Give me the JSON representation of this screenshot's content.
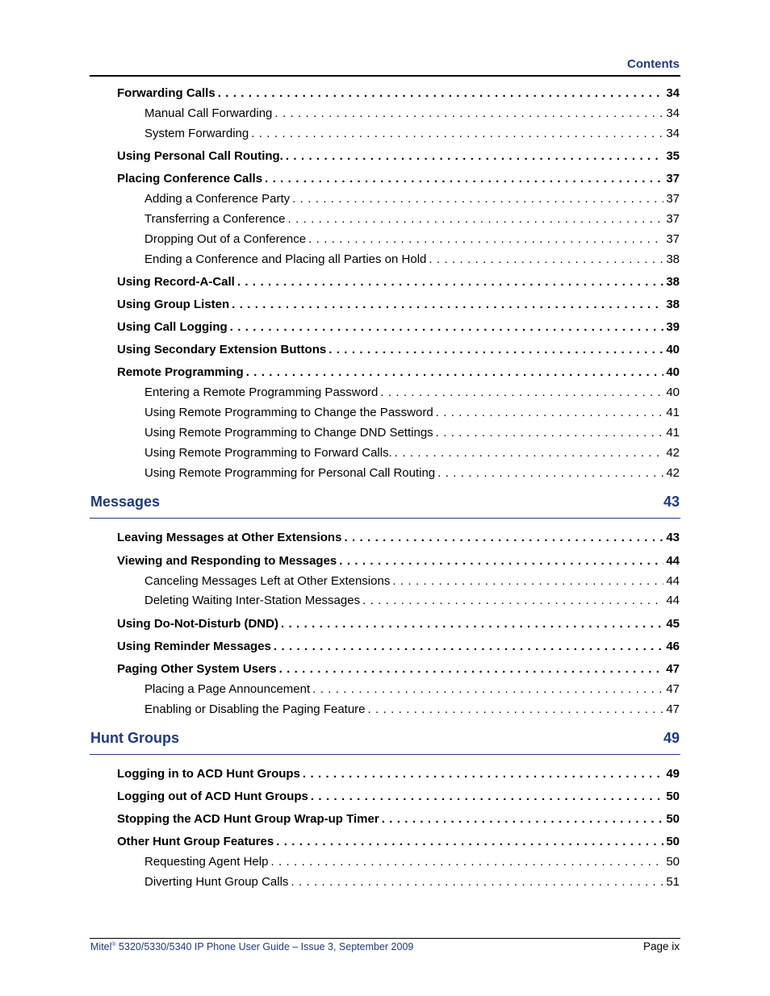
{
  "header": {
    "title": "Contents"
  },
  "sections": [
    {
      "level": 1,
      "title": "Forwarding Calls",
      "page": "34"
    },
    {
      "level": 2,
      "title": "Manual Call Forwarding",
      "page": "34"
    },
    {
      "level": 2,
      "title": "System Forwarding",
      "page": "34"
    },
    {
      "level": 1,
      "title": "Using Personal Call Routing.",
      "page": "35"
    },
    {
      "level": 1,
      "title": "Placing Conference Calls",
      "page": "37"
    },
    {
      "level": 2,
      "title": "Adding a Conference Party",
      "page": "37"
    },
    {
      "level": 2,
      "title": "Transferring a Conference",
      "page": "37"
    },
    {
      "level": 2,
      "title": "Dropping Out of a Conference",
      "page": "37"
    },
    {
      "level": 2,
      "title": "Ending a Conference and Placing all Parties on Hold",
      "page": "38"
    },
    {
      "level": 1,
      "title": "Using Record-A-Call",
      "page": "38"
    },
    {
      "level": 1,
      "title": "Using Group Listen",
      "page": "38"
    },
    {
      "level": 1,
      "title": "Using Call Logging",
      "page": "39"
    },
    {
      "level": 1,
      "title": "Using Secondary Extension Buttons",
      "page": "40"
    },
    {
      "level": 1,
      "title": "Remote Programming",
      "page": "40"
    },
    {
      "level": 2,
      "title": "Entering a Remote Programming Password",
      "page": "40"
    },
    {
      "level": 2,
      "title": "Using Remote Programming to Change the Password",
      "page": "41"
    },
    {
      "level": 2,
      "title": "Using Remote Programming to Change DND Settings",
      "page": "41"
    },
    {
      "level": 2,
      "title": "Using Remote Programming to Forward Calls.",
      "page": "42"
    },
    {
      "level": 2,
      "title": "Using Remote Programming for Personal Call Routing",
      "page": "42"
    }
  ],
  "chapters": [
    {
      "title": "Messages",
      "page": "43",
      "entries": [
        {
          "level": 1,
          "title": "Leaving Messages at Other Extensions",
          "page": "43"
        },
        {
          "level": 1,
          "title": "Viewing and Responding to Messages",
          "page": "44"
        },
        {
          "level": 2,
          "title": "Canceling Messages Left at Other Extensions",
          "page": "44"
        },
        {
          "level": 2,
          "title": "Deleting Waiting Inter-Station Messages",
          "page": "44"
        },
        {
          "level": 1,
          "title": "Using Do-Not-Disturb (DND)",
          "page": "45"
        },
        {
          "level": 1,
          "title": "Using Reminder Messages",
          "page": "46"
        },
        {
          "level": 1,
          "title": "Paging Other System Users",
          "page": "47"
        },
        {
          "level": 2,
          "title": "Placing a Page Announcement",
          "page": "47"
        },
        {
          "level": 2,
          "title": "Enabling or Disabling the Paging Feature",
          "page": "47"
        }
      ]
    },
    {
      "title": "Hunt Groups",
      "page": "49",
      "entries": [
        {
          "level": 1,
          "title": "Logging in to ACD Hunt Groups",
          "page": "49"
        },
        {
          "level": 1,
          "title": "Logging out of ACD Hunt Groups",
          "page": "50"
        },
        {
          "level": 1,
          "title": "Stopping the ACD Hunt Group Wrap-up Timer",
          "page": "50"
        },
        {
          "level": 1,
          "title": "Other Hunt Group Features",
          "page": "50"
        },
        {
          "level": 2,
          "title": "Requesting Agent Help",
          "page": "50"
        },
        {
          "level": 2,
          "title": "Diverting Hunt Group Calls",
          "page": "51"
        }
      ]
    }
  ],
  "footer": {
    "brand": "Mitel",
    "registered_mark": "®",
    "guide": " 5320/5330/5340 IP Phone User Guide  – Issue 3, September 2009",
    "page_label": "Page ix"
  }
}
